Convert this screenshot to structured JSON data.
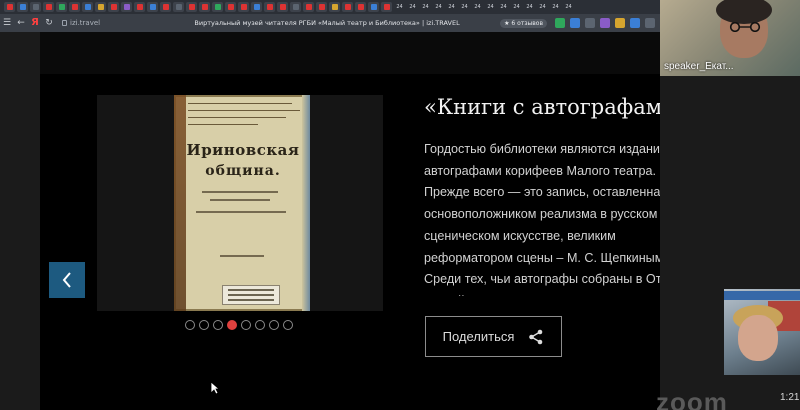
{
  "browser": {
    "brand": "Я",
    "url": "izi.travel",
    "page_title": "Виртуальный музей читателя РГБИ «Малый театр и Библиотека» | izi.TRAVEL",
    "reviews_label": "★ 6 отзывов",
    "tab_counter": "24",
    "colors": {
      "tabstrip": "#2b2f36",
      "addrbar": "#3a3f47"
    }
  },
  "modal": {
    "title": "«Книги с автографами»",
    "description": "Гордостью библиотеки являются издания с автографами корифеев Малого театра. Прежде всего — это запись, оставленная основоположником реализма в русском сценическом искусстве, великим реформатором сцены – М. С. Щепкиным. Среди тех, чьи автографы собраны в Отделе редкой книги — драматург А. Н.",
    "share_label": "Поделиться",
    "close_icon": "close-icon",
    "prev_icon": "chevron-left-icon",
    "carousel": {
      "count": 8,
      "active_index": 3
    },
    "scroll_position": 0,
    "accent_color": "#e0413e",
    "prev_button_color": "#1d5a80"
  },
  "book": {
    "title_line1": "Ириновская",
    "title_line2": "община."
  },
  "zoom": {
    "speaker_label": "speaker_Екат...",
    "logo": "zoom",
    "time": "1:21"
  }
}
